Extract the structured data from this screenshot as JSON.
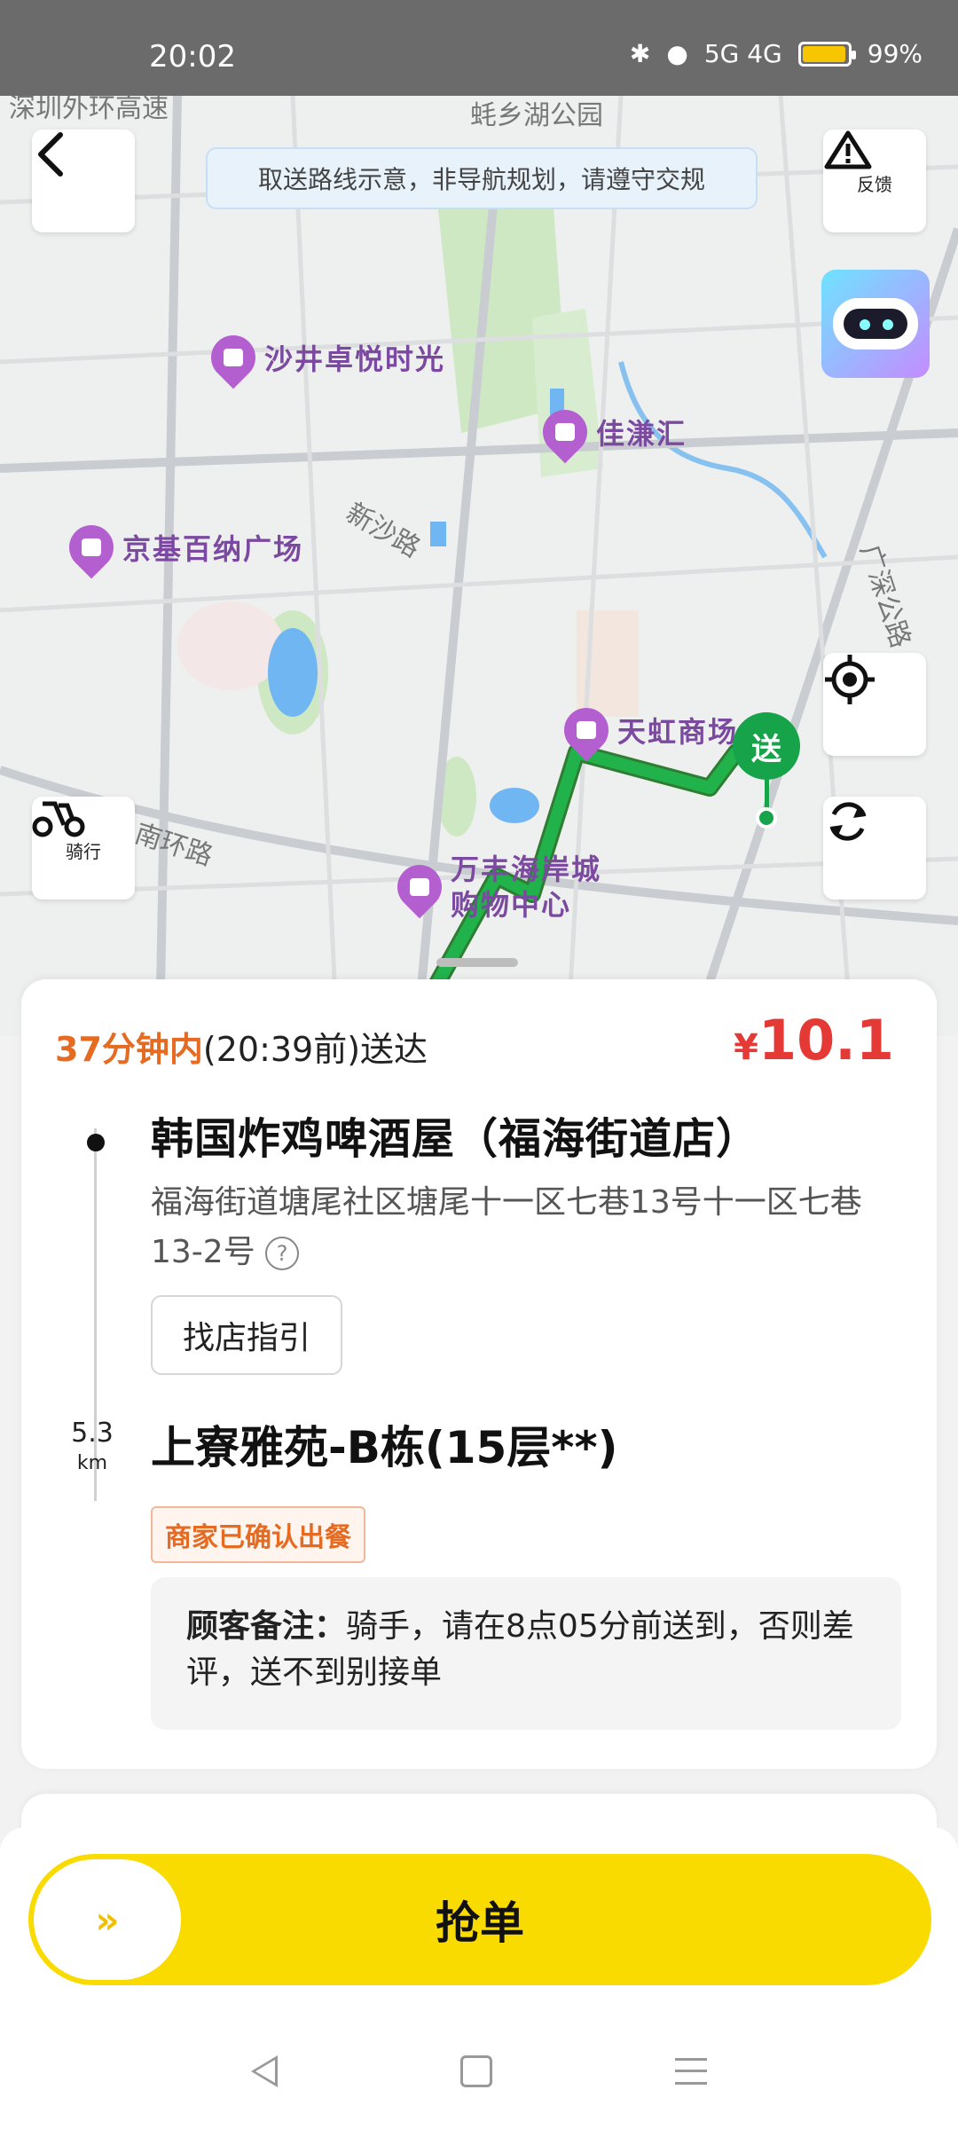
{
  "status_bar": {
    "time": "20:02",
    "battery": "99%",
    "network": "5G 4G"
  },
  "map": {
    "banner": "取送路线示意，非导航规划，请遵守交规",
    "feedback_label": "反馈",
    "ride_label": "骑行",
    "deliver_marker": "送",
    "pois": [
      {
        "name": "沙井卓悦时光"
      },
      {
        "name": "佳溓汇"
      },
      {
        "name": "京基百纳广场"
      },
      {
        "name": "天虹商场"
      },
      {
        "name": "万丰海岸城"
      },
      {
        "name": "购物中心"
      }
    ],
    "roads": [
      "新沙路",
      "南环路",
      "广深公路",
      "蚝乡湖公园",
      "深圳外环高速"
    ]
  },
  "order": {
    "eta_em": "37分钟内",
    "eta_rest": "(20:39前)送达",
    "price_symbol": "¥",
    "price_value": "10.1",
    "shop_name": "韩国炸鸡啤酒屋（福海街道店）",
    "shop_address": "福海街道塘尾社区塘尾十一区七巷13号十一区七巷13-2号",
    "help_icon": "?",
    "guide_button": "找店指引",
    "distance_value": "5.3",
    "distance_unit": "km",
    "destination": "上寮雅苑-B栋(15层**)",
    "status_badge": "商家已确认出餐",
    "note_label": "顾客备注：",
    "note_text": "骑手，请在8点05分前送到，否则差评，送不到别接单"
  },
  "action": {
    "grab_label": "抢单",
    "knob_arrows": "»"
  },
  "colors": {
    "accent": "#fadb00",
    "price": "#e53935",
    "eta": "#e56a22",
    "route": "#16a34a"
  }
}
